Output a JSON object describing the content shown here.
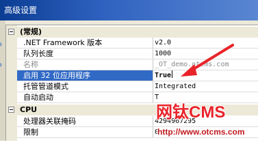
{
  "window": {
    "title": "高级设置"
  },
  "side_glyphs": [
    "?",
    "?"
  ],
  "categories": [
    {
      "label": "(常规)",
      "collapse_glyph": "−"
    },
    {
      "label": "CPU",
      "collapse_glyph": "−"
    }
  ],
  "general_rows": [
    {
      "name": ".NET Framework 版本",
      "value": "v2.0",
      "disabled": false,
      "selected": false
    },
    {
      "name": "队列长度",
      "value": "1000",
      "disabled": false,
      "selected": false
    },
    {
      "name": "名称",
      "value": "_OT_demo.otcms.com",
      "disabled": true,
      "selected": false
    },
    {
      "name": "启用 32 位应用程序",
      "value": "True",
      "disabled": false,
      "selected": true
    },
    {
      "name": "托管管道模式",
      "value": "Integrated",
      "disabled": false,
      "selected": false
    },
    {
      "name": "自动启动",
      "value": "T",
      "disabled": false,
      "selected": false
    }
  ],
  "cpu_rows": [
    {
      "name": "处理器关联掩码",
      "value": "4294967295",
      "disabled": false,
      "selected": false
    },
    {
      "name": "限制",
      "value": "0",
      "disabled": false,
      "selected": false
    }
  ],
  "watermark": {
    "brand": "网钛",
    "brand_suffix": "CMS",
    "url": "http://www.otcms.com"
  },
  "colors": {
    "selection": "#316ac5",
    "title_bar": "#0b3d93",
    "arrow": "#e8242a",
    "logo": "#e8242a"
  }
}
